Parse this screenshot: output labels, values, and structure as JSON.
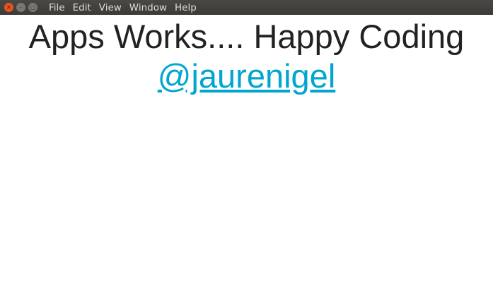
{
  "window": {
    "menu": [
      "File",
      "Edit",
      "View",
      "Window",
      "Help"
    ]
  },
  "main": {
    "heading": "Apps Works.... Happy Coding",
    "link": "@jaurenigel"
  },
  "colors": {
    "link": "#00a5d0",
    "close": "#e9541f"
  }
}
